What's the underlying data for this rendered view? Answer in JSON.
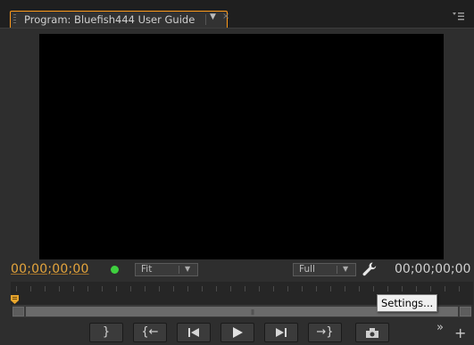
{
  "panel": {
    "tab_title": "Program: Bluefish444 User Guide",
    "tab_menu_arrow": "▼",
    "tab_close": "×",
    "panel_menu_icon": "panel-menu-icon"
  },
  "playback": {
    "current_timecode": "00;00;00;00",
    "duration_timecode": "00;00;00;00",
    "zoom_value": "Fit",
    "resolution_value": "Full",
    "dropdown_arrow": "▼",
    "status_color": "#3fd03f"
  },
  "tooltip": {
    "text": "Settings..."
  },
  "transport": {
    "mark_out": "}",
    "go_to_in": "{←",
    "step_back": "◀|",
    "play": "▶",
    "step_forward": "|▶",
    "go_to_out": "→}",
    "export_frame": "export-frame-icon",
    "more": "»",
    "add": "+"
  },
  "colors": {
    "accent": "#ff9a1a",
    "timecode": "#e5a53c"
  }
}
